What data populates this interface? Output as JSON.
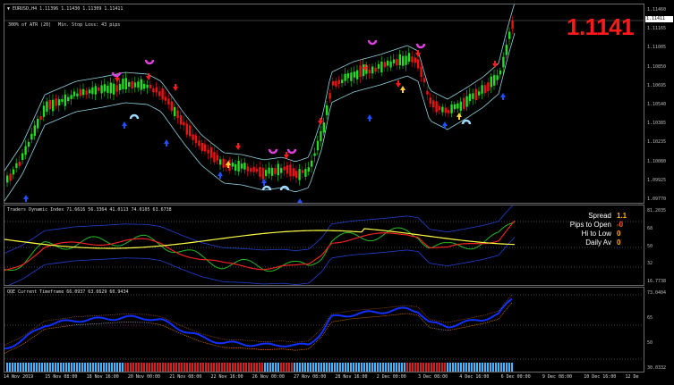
{
  "main_chart": {
    "symbol_line": "▼ EURUSD,H4  1.11396 1.11430 1.11309 1.11411",
    "atr_line": "300% of ATR (20)",
    "stop_loss_line": "Min. Stop Loss:  43 pips",
    "big_price": "1.1141",
    "current_price_tag": "1.11411",
    "price_axis": [
      "1.11460",
      "1.11165",
      "1.11005",
      "1.10850",
      "1.10695",
      "1.10540",
      "1.10385",
      "1.10235",
      "1.10080",
      "1.09925",
      "1.09770"
    ],
    "colors": {
      "bull": "#22dd22",
      "bear": "#ee1111",
      "band": "#8fd3e0",
      "up_arrow": "#1f4fff",
      "down_arrow": "#ff1a1a",
      "magenta": "#e040e0",
      "light_blue": "#9fd8ff",
      "yellow_arrow": "#ffd23a"
    }
  },
  "tdi_pane": {
    "title": "Traders Dynamic Index 71.6616 56.3364 41.0113 74.0105 63.6738",
    "axis": [
      "81.2035",
      "68",
      "50",
      "32",
      "16.7738"
    ],
    "info": [
      {
        "key": "Spread",
        "value": "1.1"
      },
      {
        "key": "Pips to Open",
        "value": "-0"
      },
      {
        "key": "Hi to Low",
        "value": "0"
      },
      {
        "key": "Daily Av",
        "value": "0"
      }
    ]
  },
  "qqe_pane": {
    "title": "QQE Current Timeframe 66.0937 63.6629 60.9434",
    "axis": [
      "73.0404",
      "65",
      "50",
      "30.0332"
    ],
    "colors": {
      "blue": "#1030ff",
      "orange": "#ff8800",
      "bar_blue": "#3fb8ff",
      "bar_red": "#d02020"
    }
  },
  "time_axis": [
    "14 Nov 2019",
    "15 Nov 08:00",
    "18 Nov 16:00",
    "20 Nov 00:00",
    "21 Nov 08:00",
    "22 Nov 16:00",
    "26 Nov 00:00",
    "27 Nov 08:00",
    "28 Nov 16:00",
    "2 Dec 00:00",
    "3 Dec 08:00",
    "4 Dec 16:00",
    "6 Dec 00:00",
    "9 Dec 08:00",
    "10 Dec 16:00",
    "12 De"
  ]
}
